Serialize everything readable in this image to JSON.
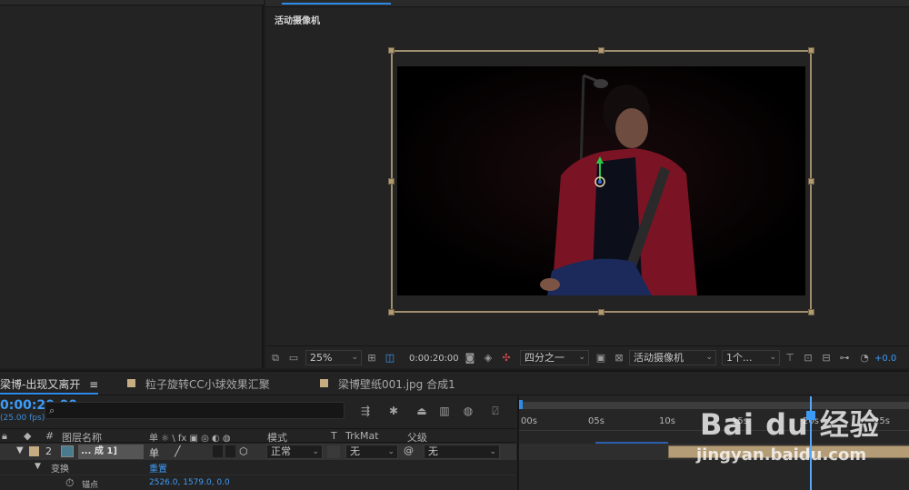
{
  "viewer": {
    "panel_label": "活动摄像机",
    "zoom": "25%",
    "timecode": "0:00:20:00",
    "resolution": "四分之一",
    "camera": "活动摄像机",
    "views": "1个...",
    "exposure": "+0.0"
  },
  "timeline": {
    "tabs": [
      {
        "label": "梁博-出现又离开",
        "menu": "≡"
      },
      {
        "label": "粒子旋转CC小球效果汇聚"
      },
      {
        "label": "梁博壁纸001.jpg 合成1"
      }
    ],
    "current_time": "0:00:20:00",
    "fps": "(25.00 fps)",
    "search_placeholder": "",
    "headers": {
      "number": "#",
      "layer_name": "图层名称",
      "switches": "单 ☼ \\ fx ▣ ◎ ◐ ◍",
      "mode": "模式",
      "t": "T",
      "trkmat": "TrkMat",
      "parent": "父级"
    },
    "layer": {
      "index": "2",
      "name": "... 成 1]",
      "mode": "正常",
      "trkmat": "无",
      "parent": "无",
      "switch": "单"
    },
    "transform": {
      "label": "变换",
      "reset": "重置",
      "anchor_label": "锚点",
      "anchor_value": "2526.0, 1579.0, 0.0"
    },
    "ruler_ticks": [
      "00s",
      "05s",
      "10s",
      "15s",
      "20s",
      "25s"
    ]
  },
  "watermark": {
    "logo": "Bai du 经验",
    "url": "jingyan.baidu.com"
  },
  "colors": {
    "accent": "#2d8ceb",
    "label_sandstone": "#c5ac81",
    "panel_bg": "#232323"
  }
}
